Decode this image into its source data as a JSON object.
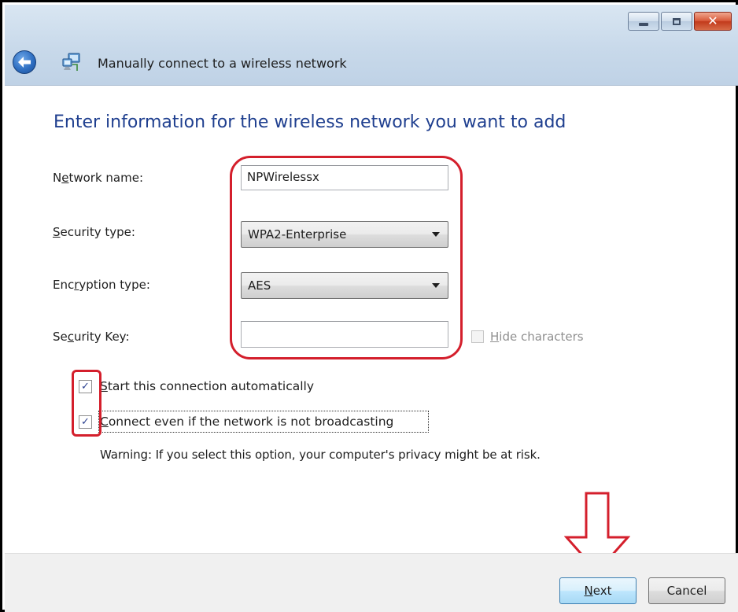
{
  "window": {
    "title": "Manually connect to a wireless network",
    "controls": {
      "minimize": "minimize-icon",
      "maximize": "maximize-icon",
      "close": "close-icon"
    }
  },
  "heading": "Enter information for the wireless network you want to add",
  "form": {
    "network_name": {
      "label_pre": "N",
      "label_key": "e",
      "label_post": "twork name:",
      "value": "NPWirelessx"
    },
    "security_type": {
      "label_pre": "",
      "label_key": "S",
      "label_post": "ecurity type:",
      "value": "WPA2-Enterprise"
    },
    "encryption_type": {
      "label_pre": "Enc",
      "label_key": "r",
      "label_post": "yption type:",
      "value": "AES"
    },
    "security_key": {
      "label_pre": "Se",
      "label_key": "c",
      "label_post": "urity Key:",
      "value": ""
    },
    "hide_characters": {
      "label_key": "H",
      "label_post": "ide characters",
      "checked": false,
      "enabled": false
    }
  },
  "options": {
    "start_auto": {
      "label_key": "S",
      "label_post": "tart this connection automatically",
      "checked": true
    },
    "connect_hidden": {
      "label_key": "C",
      "label_post": "onnect even if the network is not broadcasting",
      "checked": true
    },
    "warning": "Warning: If you select this option, your computer's privacy might be at risk."
  },
  "check_glyph": "✓",
  "buttons": {
    "next_key": "N",
    "next_post": "ext",
    "cancel": "Cancel"
  },
  "colors": {
    "annotation": "#d41f2c",
    "heading": "#1f3f8f"
  }
}
